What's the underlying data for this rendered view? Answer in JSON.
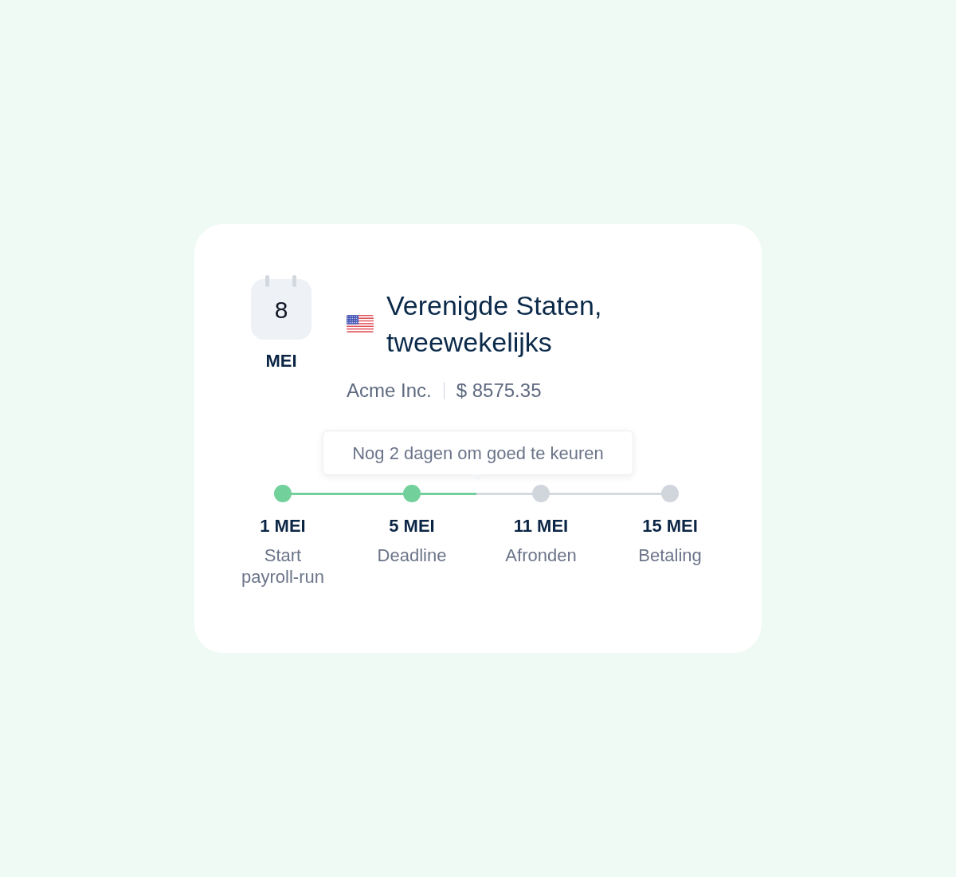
{
  "calendar": {
    "day": "8",
    "month": "MEI"
  },
  "header": {
    "title": "Verenigde Staten, tweewekelijks",
    "company": "Acme Inc.",
    "amount": "$ 8575.35"
  },
  "tooltip": {
    "text": "Nog 2 dagen om goed te keuren"
  },
  "progress": {
    "level": 0.5
  },
  "steps": [
    {
      "date": "1 MEI",
      "label": "Start payroll-run",
      "done": true
    },
    {
      "date": "5 MEI",
      "label": "Deadline",
      "done": true
    },
    {
      "date": "11 MEI",
      "label": "Afronden",
      "done": false
    },
    {
      "date": "15 MEI",
      "label": "Betaling",
      "done": false
    }
  ]
}
